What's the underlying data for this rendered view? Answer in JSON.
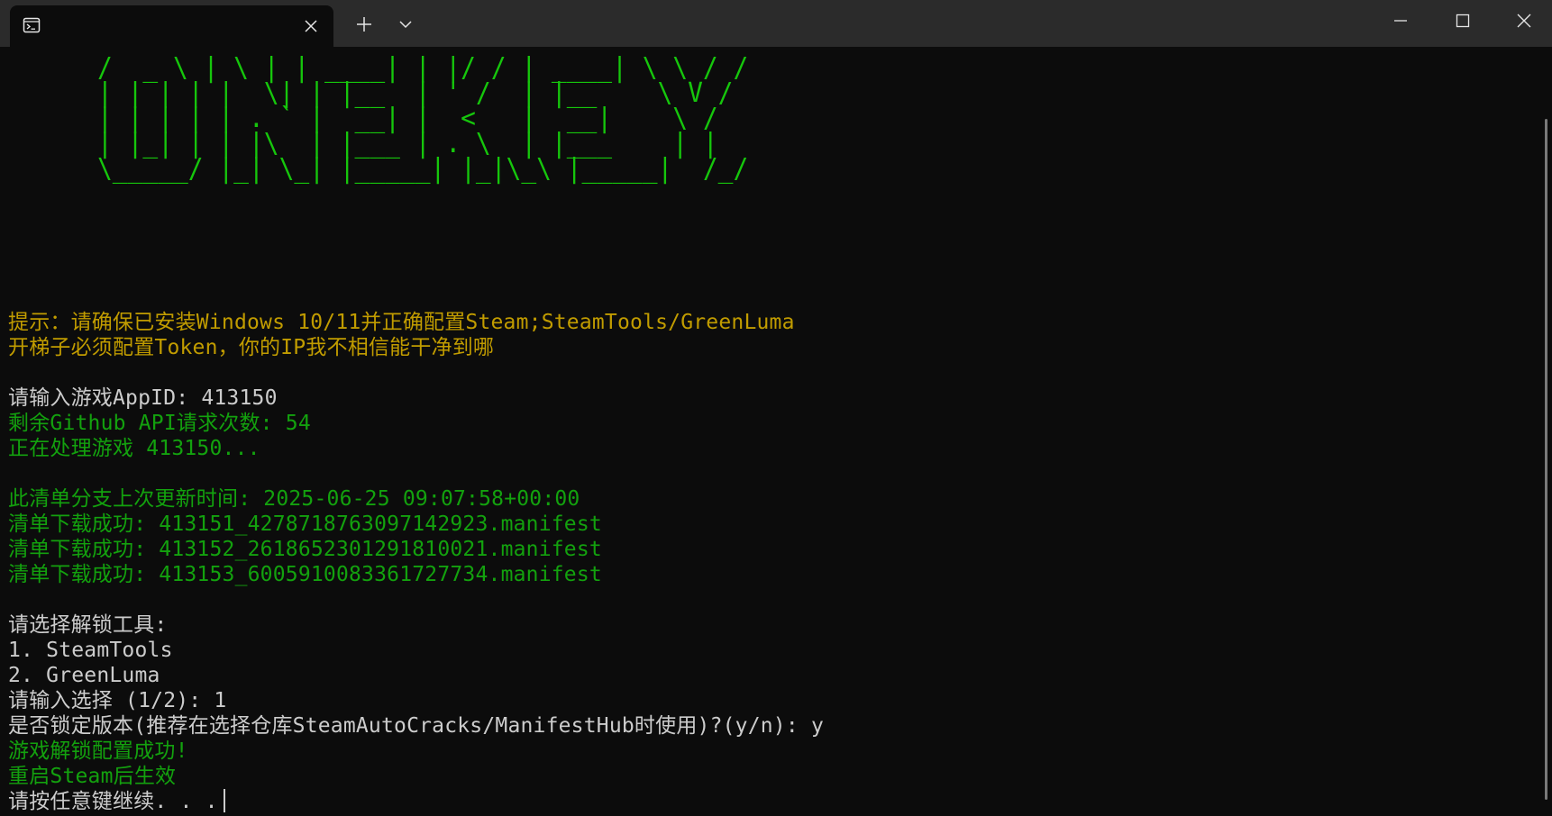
{
  "titlebar": {
    "tab_icon": "terminal-icon",
    "close_icon": "close-icon",
    "new_tab_icon": "plus-icon",
    "dropdown_icon": "chevron-down-icon",
    "window_controls": [
      "minimize-icon",
      "maximize-icon",
      "close-icon"
    ]
  },
  "terminal": {
    "banner": [
      "/  _ \\ | \\ | | ____| | |/ / | ____| \\ \\ / /",
      "| | | | |  \\| | |__  | ' /  | |__    \\ V / ",
      "| | | | | . ` |  __| |  <   |  __|    \\ /  ",
      "| |_| | | |\\  | |___ | . \\  | |___    | |  ",
      "\\_____/ |_| \\_| |_____| |_|\\_\\ |_____|  /_/  "
    ],
    "lines": [
      {
        "text": "提示：请确保已安装Windows 10/11并正确配置Steam;SteamTools/GreenLuma",
        "color": "#c19c00"
      },
      {
        "text": "开梯子必须配置Token，你的IP我不相信能干净到哪",
        "color": "#c19c00"
      },
      {
        "text": "",
        "color": "#cccccc"
      },
      {
        "text": "请输入游戏AppID: 413150",
        "color": "#cccccc"
      },
      {
        "text": "剩余Github API请求次数: 54",
        "color": "#13a10e"
      },
      {
        "text": "正在处理游戏 413150...",
        "color": "#13a10e"
      },
      {
        "text": "",
        "color": "#cccccc"
      },
      {
        "text": "此清单分支上次更新时间: 2025-06-25 09:07:58+00:00",
        "color": "#13a10e"
      },
      {
        "text": "清单下载成功: 413151_4278718763097142923.manifest",
        "color": "#13a10e"
      },
      {
        "text": "清单下载成功: 413152_2618652301291810021.manifest",
        "color": "#13a10e"
      },
      {
        "text": "清单下载成功: 413153_6005910083361727734.manifest",
        "color": "#13a10e"
      },
      {
        "text": "",
        "color": "#cccccc"
      },
      {
        "text": "请选择解锁工具:",
        "color": "#cccccc"
      },
      {
        "text": "1. SteamTools",
        "color": "#cccccc"
      },
      {
        "text": "2. GreenLuma",
        "color": "#cccccc"
      },
      {
        "text": "请输入选择 (1/2): 1",
        "color": "#cccccc"
      },
      {
        "text": "是否锁定版本(推荐在选择仓库SteamAutoCracks/ManifestHub时使用)?(y/n): y",
        "color": "#cccccc"
      },
      {
        "text": "游戏解锁配置成功!",
        "color": "#13a10e"
      },
      {
        "text": "重启Steam后生效",
        "color": "#13a10e"
      },
      {
        "text": "请按任意键继续. . .",
        "color": "#cccccc"
      }
    ]
  },
  "colors": {
    "background": "#0c0c0c",
    "titlebar": "#2b2b2b",
    "banner_green": "#16c60c",
    "yellow": "#c19c00",
    "green": "#13a10e",
    "white": "#cccccc"
  }
}
